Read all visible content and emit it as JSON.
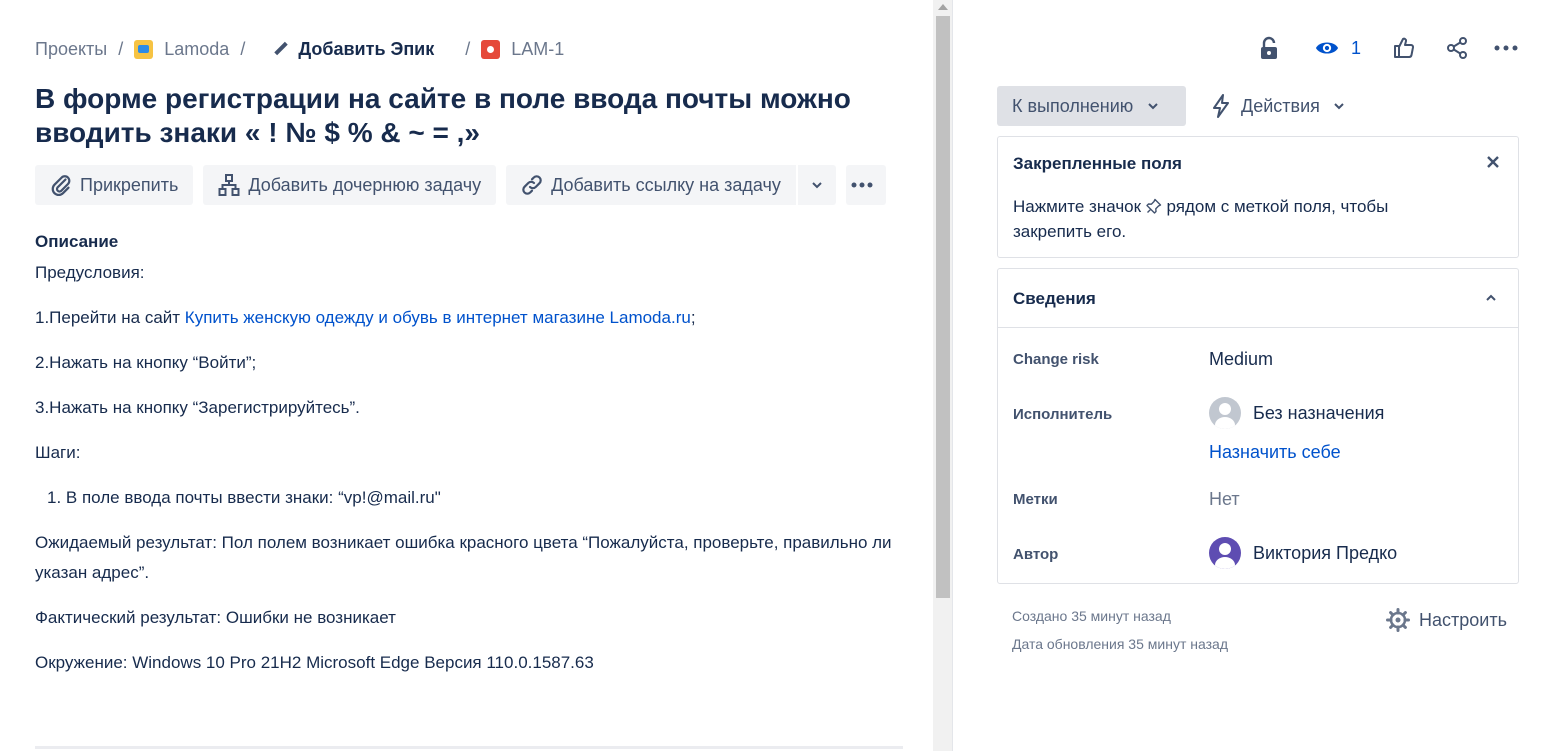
{
  "breadcrumb": {
    "projects": "Проекты",
    "project": "Lamoda",
    "epic": "Добавить Эпик",
    "issue_key": "LAM-1",
    "separator": "/"
  },
  "issue": {
    "title": "В форме регистрации на сайте в поле ввода почты можно вводить знаки « ! № $ % & ~ = ,»"
  },
  "toolbar": {
    "attach": "Прикрепить",
    "add_child": "Добавить дочернюю задачу",
    "add_link": "Добавить ссылку на задачу"
  },
  "description": {
    "heading": "Описание",
    "preconditions": "Предусловия:",
    "step1_prefix": "1.Перейти на сайт ",
    "step1_link": "Купить женскую одежду и обувь в интернет магазине Lamoda.ru",
    "step1_suffix": ";",
    "step2": "2.Нажать на кнопку “Войти”;",
    "step3": "3.Нажать на кнопку “Зарегистрируйтесь”.",
    "steps_heading": "Шаги:",
    "steps_item": "1. В поле ввода почты ввести знаки: “vp!@mail.ru\"",
    "expected": "Ожидаемый результат: Пол полем возникает ошибка красного цвета “Пожалуйста, проверьте, правильно ли указан адрес”.",
    "actual": "Фактический результат: Ошибки не возникает",
    "environment": "Окружение: Windows 10 Pro 21H2 Microsoft Edge Версия 110.0.1587.63"
  },
  "header_actions": {
    "watch_count": "1",
    "icons": [
      "lock-icon",
      "eye-icon",
      "thumbs-up-icon",
      "share-icon",
      "more-icon"
    ]
  },
  "status": {
    "label": "К выполнению",
    "actions": "Действия"
  },
  "pinned": {
    "title": "Закрепленные поля",
    "text_before": "Нажмите значок ",
    "text_after": " рядом с меткой поля, чтобы закрепить его."
  },
  "details": {
    "title": "Сведения",
    "change_risk_label": "Change risk",
    "change_risk_value": "Medium",
    "assignee_label": "Исполнитель",
    "assignee_value": "Без назначения",
    "assign_self": "Назначить себе",
    "labels_label": "Метки",
    "labels_value": "Нет",
    "reporter_label": "Автор",
    "reporter_value": "Виктория Предко"
  },
  "meta": {
    "created": "Создано 35 минут назад",
    "updated": "Дата обновления 35 минут назад",
    "configure": "Настроить"
  },
  "colors": {
    "link": "#0052cc",
    "text": "#172b4d",
    "muted": "#6b778c",
    "button_bg": "#f4f5f7",
    "status_bg": "#dfe1e6"
  }
}
